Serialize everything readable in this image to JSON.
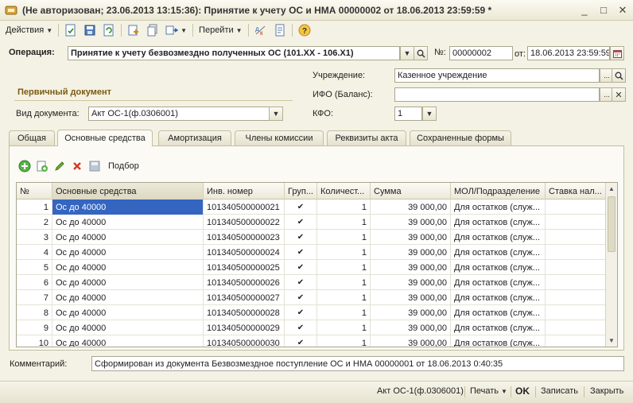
{
  "window": {
    "title": "(Не авторизован; 23.06.2013 13:15:36): Принятие к учету ОС и НМА 00000002 от 18.06.2013 23:59:59 *",
    "minimize": "_",
    "maximize": "□",
    "close": "✕"
  },
  "toolbar": {
    "actions_label": "Действия",
    "goto_label": "Перейти",
    "icons": [
      "post-and-close-icon",
      "save-icon",
      "refresh-icon",
      "create-based-on-icon",
      "copy-icon",
      "structure-icon",
      "dt-kt-icon",
      "report-icon",
      "help-icon"
    ]
  },
  "form": {
    "operation_label": "Операция:",
    "operation_value": "Принятие к учету безвозмездно полученных ОС  (101.ХХ - 106.Х1)",
    "number_label": "№:",
    "number_value": "00000002",
    "date_label": "от:",
    "date_value": "18.06.2013 23:59:59",
    "institution_label": "Учреждение:",
    "institution_value": "Казенное учреждение",
    "ifo_label": "ИФО (Баланс):",
    "ifo_value": "",
    "kfo_label": "КФО:",
    "kfo_value": "1",
    "primary_doc_title": "Первичный документ",
    "doc_type_label": "Вид документа:",
    "doc_type_value": "Акт ОС-1(ф.0306001)",
    "comment_label": "Комментарий:",
    "comment_value": "Сформирован из документа Безвозмездное поступление ОС и НМА 00000001 от 18.06.2013 0:40:35"
  },
  "tabs": [
    "Общая",
    "Основные средства",
    "Амортизация",
    "Члены комиссии",
    "Реквизиты акта",
    "Сохраненные формы"
  ],
  "active_tab": "Основные средства",
  "grid_toolbar": {
    "pick_label": "Подбор"
  },
  "table": {
    "columns": [
      "№",
      "Основные средства",
      "Инв. номер",
      "Груп...",
      "Количест...",
      "Сумма",
      "МОЛ/Подразделение",
      "Ставка нал..."
    ],
    "rows": [
      {
        "n": "1",
        "asset": "Ос до 40000",
        "inv": "101340500000021",
        "group": "✔",
        "qty": "1",
        "sum": "39 000,00",
        "mol": "Для остатков (служ...",
        "rate": ""
      },
      {
        "n": "2",
        "asset": "Ос до 40000",
        "inv": "101340500000022",
        "group": "✔",
        "qty": "1",
        "sum": "39 000,00",
        "mol": "Для остатков (служ...",
        "rate": ""
      },
      {
        "n": "3",
        "asset": "Ос до 40000",
        "inv": "101340500000023",
        "group": "✔",
        "qty": "1",
        "sum": "39 000,00",
        "mol": "Для остатков (служ...",
        "rate": ""
      },
      {
        "n": "4",
        "asset": "Ос до 40000",
        "inv": "101340500000024",
        "group": "✔",
        "qty": "1",
        "sum": "39 000,00",
        "mol": "Для остатков (служ...",
        "rate": ""
      },
      {
        "n": "5",
        "asset": "Ос до 40000",
        "inv": "101340500000025",
        "group": "✔",
        "qty": "1",
        "sum": "39 000,00",
        "mol": "Для остатков (служ...",
        "rate": ""
      },
      {
        "n": "6",
        "asset": "Ос до 40000",
        "inv": "101340500000026",
        "group": "✔",
        "qty": "1",
        "sum": "39 000,00",
        "mol": "Для остатков (служ...",
        "rate": ""
      },
      {
        "n": "7",
        "asset": "Ос до 40000",
        "inv": "101340500000027",
        "group": "✔",
        "qty": "1",
        "sum": "39 000,00",
        "mol": "Для остатков (служ...",
        "rate": ""
      },
      {
        "n": "8",
        "asset": "Ос до 40000",
        "inv": "101340500000028",
        "group": "✔",
        "qty": "1",
        "sum": "39 000,00",
        "mol": "Для остатков (служ...",
        "rate": ""
      },
      {
        "n": "9",
        "asset": "Ос до 40000",
        "inv": "101340500000029",
        "group": "✔",
        "qty": "1",
        "sum": "39 000,00",
        "mol": "Для остатков (служ...",
        "rate": ""
      },
      {
        "n": "10",
        "asset": "Ос до 40000",
        "inv": "101340500000030",
        "group": "✔",
        "qty": "1",
        "sum": "39 000,00",
        "mol": "Для остатков (служ...",
        "rate": ""
      }
    ]
  },
  "footer": {
    "form_link": "Акт ОС-1(ф.0306001)",
    "print_label": "Печать",
    "ok_label": "OK",
    "save_label": "Записать",
    "close_label": "Закрыть"
  }
}
